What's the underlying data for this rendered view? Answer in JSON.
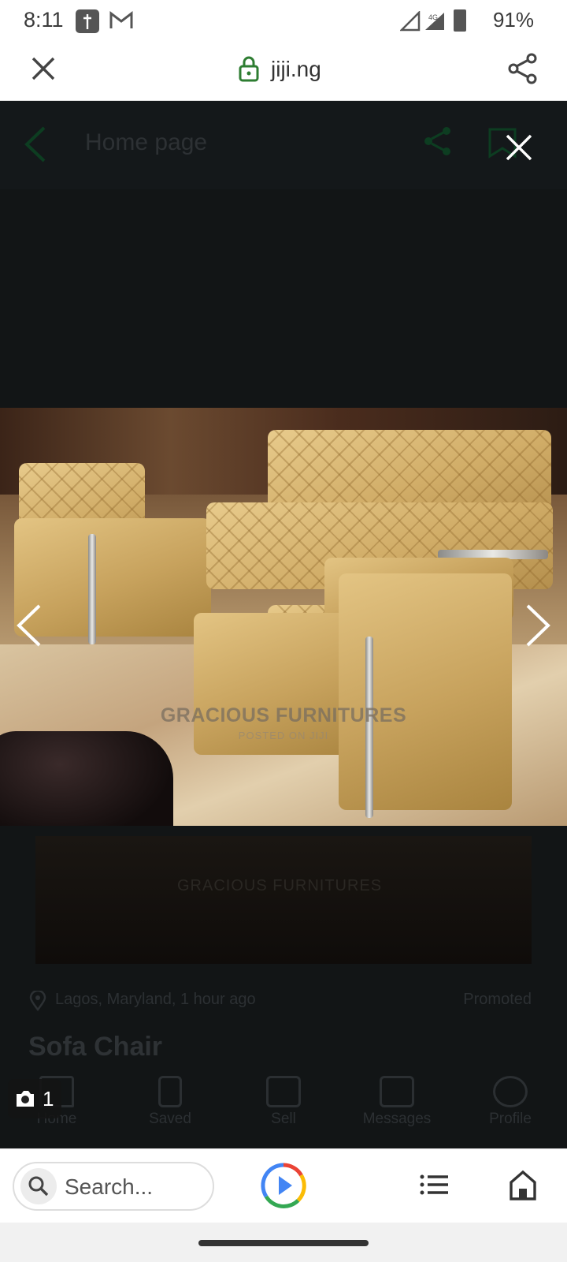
{
  "status_bar": {
    "time": "8:11",
    "network": "4G",
    "battery": "91%",
    "icons": [
      "cross-notification-icon",
      "gmail-icon",
      "signal-icon",
      "battery-icon"
    ]
  },
  "browser_bar": {
    "domain": "jiji.ng",
    "close_icon": "close-icon",
    "lock_icon": "lock-icon",
    "share_icon": "share-icon"
  },
  "underlying_page": {
    "header_title": "Home page",
    "thumbnail_watermark": "GRACIOUS FURNITURES",
    "location": "Lagos, Maryland, 1 hour ago",
    "promoted_label": "Promoted",
    "listing_title": "Sofa Chair",
    "bottom_nav": [
      {
        "label": "Home",
        "icon": "home-icon"
      },
      {
        "label": "Saved",
        "icon": "bookmark-icon"
      },
      {
        "label": "Sell",
        "icon": "plus-icon"
      },
      {
        "label": "Messages",
        "icon": "chat-icon"
      },
      {
        "label": "Profile",
        "icon": "profile-icon"
      }
    ]
  },
  "lightbox": {
    "watermark": "GRACIOUS FURNITURES",
    "watermark_sub": "POSTED ON JIJI",
    "photo_count": "1",
    "image_subject": "gold quilted leather sofa set"
  },
  "chrome_bottom": {
    "search_placeholder": "Search...",
    "icons": [
      "search-icon",
      "google-play-icon",
      "tabs-list-icon",
      "home-icon"
    ]
  },
  "colors": {
    "accent_lock": "#2e7d32",
    "page_bg": "#121516",
    "sofa_gold": "#d1ad68"
  }
}
